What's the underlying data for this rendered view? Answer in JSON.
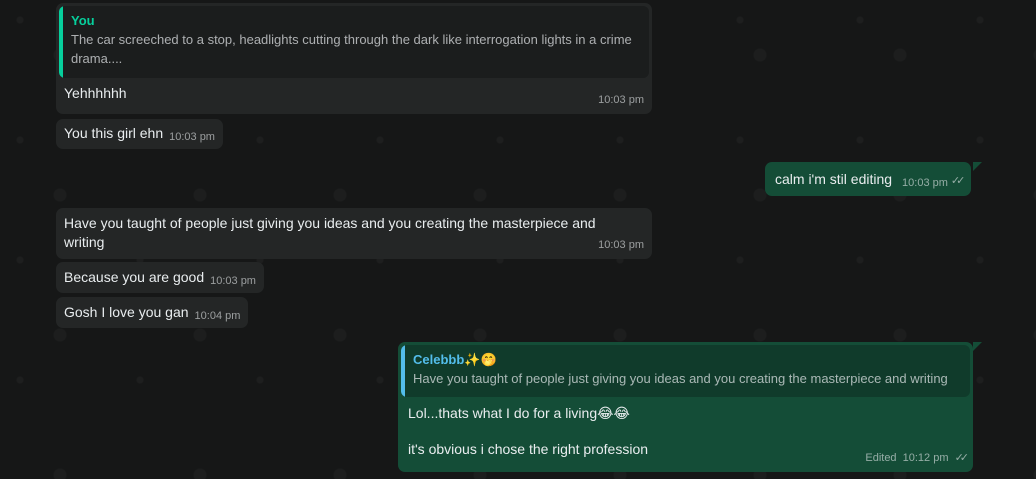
{
  "messages": {
    "m1": {
      "quote_author": "You",
      "quote_text": "The car screeched to a stop, headlights cutting through the dark like interrogation lights in a crime drama....",
      "text": "Yehhhhhh",
      "time": "10:03 pm"
    },
    "m2": {
      "text": "You this girl ehn",
      "time": "10:03 pm"
    },
    "m3": {
      "text": "calm i'm stil editing",
      "time": "10:03 pm"
    },
    "m4": {
      "text": "Have you taught of people just giving you ideas and you creating the masterpiece and writing",
      "time": "10:03 pm"
    },
    "m5": {
      "text": "Because you are good",
      "time": "10:03 pm"
    },
    "m6": {
      "text": "Gosh I love you gan",
      "time": "10:04 pm"
    },
    "m7": {
      "quote_author": "Celebbb✨🤭",
      "quote_text": "Have you taught of people just giving you ideas and you creating the masterpiece and writing",
      "line1": "Lol...thats what I do for a living😂😂",
      "line2": "it's obvious i chose the right profession",
      "edited": "Edited",
      "time": "10:12 pm"
    }
  },
  "colors": {
    "incoming_bubble": "#242626",
    "outgoing_bubble": "#144d37",
    "quote_you_bar": "#06cf9c",
    "quote_celeb_bar": "#53bdeb",
    "quote_you_author": "#06cf9c",
    "quote_celeb_author": "#53bdeb"
  },
  "icons": {
    "read_receipt": "double-check-icon"
  }
}
